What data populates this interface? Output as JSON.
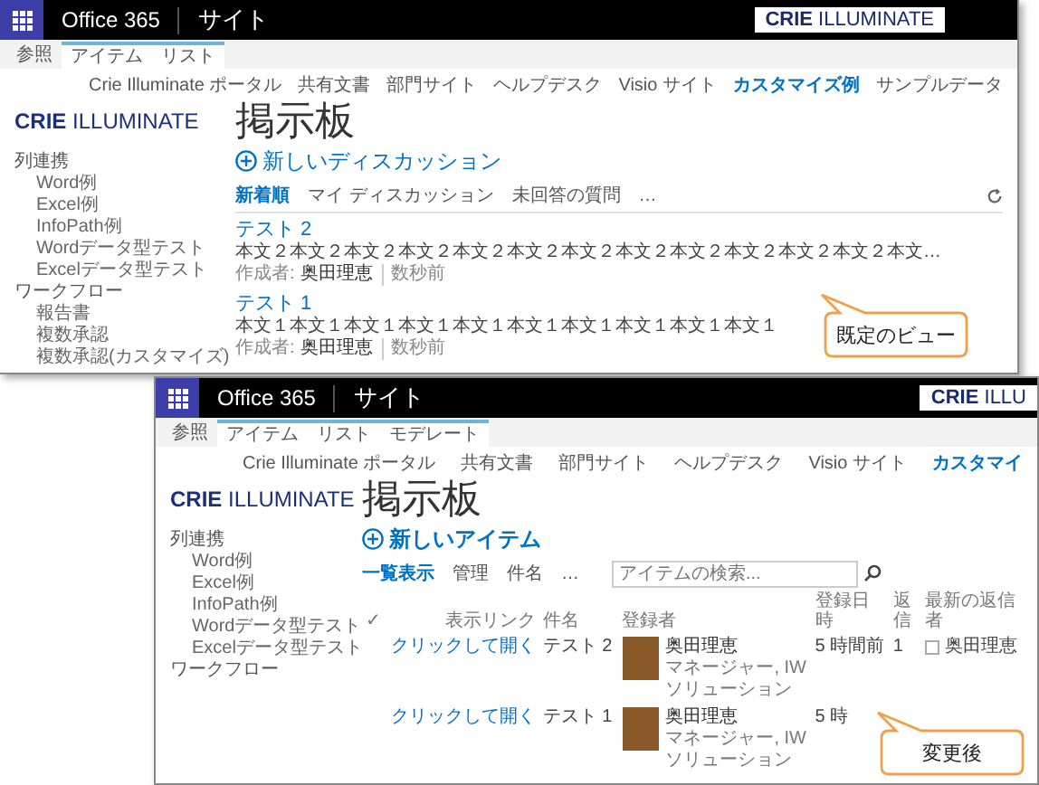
{
  "default_view": {
    "suite_bar": {
      "app": "Office 365",
      "site": "サイト",
      "logo": "**CRIE** ILLUMINATE"
    },
    "ribbon_tabs": [
      {
        "label": "参照",
        "contextual": false
      },
      {
        "label": "アイテム",
        "contextual": true
      },
      {
        "label": "リスト",
        "contextual": true
      }
    ],
    "top_nav": [
      {
        "label": "Crie Illuminate ポータル",
        "selected": false
      },
      {
        "label": "共有文書",
        "selected": false
      },
      {
        "label": "部門サイト",
        "selected": false
      },
      {
        "label": "ヘルプデスク",
        "selected": false
      },
      {
        "label": "Visio サイト",
        "selected": false
      },
      {
        "label": "カスタマイズ例",
        "selected": true
      },
      {
        "label": "サンプルデータ",
        "selected": false
      }
    ],
    "site_logo": "**CRIE** ILLUMINATE",
    "page_title": "掲示板",
    "quick_launch": [
      {
        "label": "列連携",
        "children": [
          {
            "label": "Word例"
          },
          {
            "label": "Excel例"
          },
          {
            "label": "InfoPath例"
          },
          {
            "label": "Wordデータ型テスト"
          },
          {
            "label": "Excelデータ型テスト"
          }
        ]
      },
      {
        "label": "ワークフロー",
        "children": [
          {
            "label": "報告書"
          },
          {
            "label": "複数承認"
          },
          {
            "label": "複数承認(カスタマイズ)"
          }
        ]
      }
    ],
    "new_action": "新しいディスカッション",
    "view_tabs": [
      {
        "label": "新着順",
        "selected": true
      },
      {
        "label": "マイ ディスカッション",
        "selected": false
      },
      {
        "label": "未回答の質問",
        "selected": false
      }
    ],
    "more": "…",
    "posts": [
      {
        "title": "テスト 2",
        "body": "本文２本文２本文２本文２本文２本文２本文２本文２本文２本文２本文２本文２本文…",
        "author_label": "作成者:",
        "author": "奥田理恵",
        "time": "数秒前"
      },
      {
        "title": "テスト 1",
        "body": "本文１本文１本文１本文１本文１本文１本文１本文１本文１本文１",
        "author_label": "作成者:",
        "author": "奥田理恵",
        "time": "数秒前"
      }
    ],
    "callout": "既定のビュー"
  },
  "changed_view": {
    "suite_bar": {
      "app": "Office 365",
      "site": "サイト",
      "logo": "**CRIE** ILLU"
    },
    "ribbon_tabs": [
      {
        "label": "参照",
        "contextual": false
      },
      {
        "label": "アイテム",
        "contextual": true
      },
      {
        "label": "リスト",
        "contextual": true
      },
      {
        "label": "モデレート",
        "contextual": true
      }
    ],
    "top_nav": [
      {
        "label": "Crie Illuminate ポータル",
        "selected": false
      },
      {
        "label": "共有文書",
        "selected": false
      },
      {
        "label": "部門サイト",
        "selected": false
      },
      {
        "label": "ヘルプデスク",
        "selected": false
      },
      {
        "label": "Visio サイト",
        "selected": false
      },
      {
        "label": "カスタマイ",
        "selected": true
      }
    ],
    "site_logo": "**CRIE** ILLUMINATE",
    "page_title": "掲示板",
    "quick_launch": [
      {
        "label": "列連携",
        "children": [
          {
            "label": "Word例"
          },
          {
            "label": "Excel例"
          },
          {
            "label": "InfoPath例"
          },
          {
            "label": "Wordデータ型テスト"
          },
          {
            "label": "Excelデータ型テスト"
          }
        ]
      },
      {
        "label": "ワークフロー"
      }
    ],
    "new_action": "新しいアイテム",
    "view_tabs": [
      {
        "label": "一覧表示",
        "selected": true
      },
      {
        "label": "管理",
        "selected": false
      },
      {
        "label": "件名",
        "selected": false
      }
    ],
    "more": "…",
    "search": {
      "placeholder": "アイテムの検索..."
    },
    "table": {
      "columns": [
        "✓",
        "表示リンク",
        "件名",
        "登録者",
        "登録日時",
        "返信",
        "最新の返信者"
      ],
      "rows": [
        {
          "link": "クリックして開く",
          "subject": "テスト 2",
          "author": "奥田理恵",
          "role": "マネージャー, IWソリューション",
          "date": "5 時間前",
          "replies": "1",
          "last_replier": "奥田理恵"
        },
        {
          "link": "クリックして開く",
          "subject": "テスト 1",
          "author": "奥田理恵",
          "role": "マネージャー, IWソリューション",
          "date": "5 時"
        }
      ]
    },
    "callout": "変更後"
  }
}
